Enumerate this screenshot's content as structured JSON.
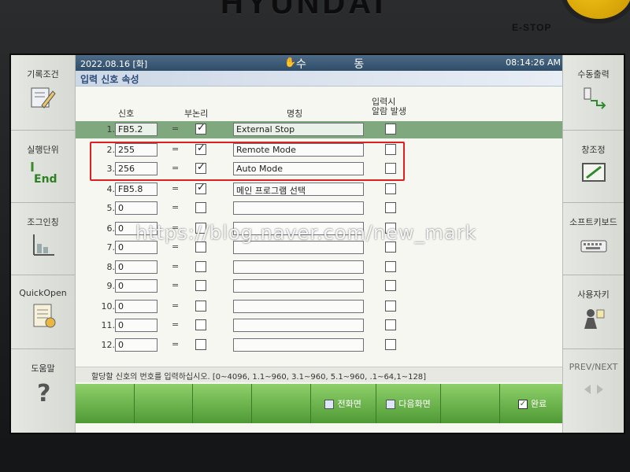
{
  "device": {
    "brand": "HYUNDAI",
    "estop_label": "E-STOP"
  },
  "status": {
    "date": "2022.08.16 [화]",
    "mode": "수 동",
    "time": "08:14:26 AM"
  },
  "screen_title": "입력 신호 속성",
  "columns": {
    "signal": "신호",
    "negation": "부논리",
    "name": "명칭",
    "alarm": "입력시\n알람 발생"
  },
  "rows": [
    {
      "num": "1.",
      "addr": "FB5.2",
      "eq": "=",
      "neg": true,
      "name": "External Stop",
      "alarm": false
    },
    {
      "num": "2.",
      "addr": "255",
      "eq": "=",
      "neg": true,
      "name": "Remote Mode",
      "alarm": false
    },
    {
      "num": "3.",
      "addr": "256",
      "eq": "=",
      "neg": true,
      "name": "Auto Mode",
      "alarm": false
    },
    {
      "num": "4.",
      "addr": "FB5.8",
      "eq": "=",
      "neg": true,
      "name": "메인 프로그램 선택",
      "alarm": false
    },
    {
      "num": "5.",
      "addr": "0",
      "eq": "=",
      "neg": false,
      "name": "",
      "alarm": false
    },
    {
      "num": "6.",
      "addr": "0",
      "eq": "=",
      "neg": false,
      "name": "",
      "alarm": false
    },
    {
      "num": "7.",
      "addr": "0",
      "eq": "=",
      "neg": false,
      "name": "",
      "alarm": false
    },
    {
      "num": "8.",
      "addr": "0",
      "eq": "=",
      "neg": false,
      "name": "",
      "alarm": false
    },
    {
      "num": "9.",
      "addr": "0",
      "eq": "=",
      "neg": false,
      "name": "",
      "alarm": false
    },
    {
      "num": "10.",
      "addr": "0",
      "eq": "=",
      "neg": false,
      "name": "",
      "alarm": false
    },
    {
      "num": "11.",
      "addr": "0",
      "eq": "=",
      "neg": false,
      "name": "",
      "alarm": false
    },
    {
      "num": "12.",
      "addr": "0",
      "eq": "=",
      "neg": false,
      "name": "",
      "alarm": false
    }
  ],
  "hint": "할당할 신호의 번호를 입력하십시오. [0~4096, 1.1~960, 3.1~960, 5.1~960, .1~64,1~128]",
  "left_menu": [
    {
      "label": "기록조건",
      "icon": "edit-pencil-icon"
    },
    {
      "label": "실행단위",
      "icon": "end-icon"
    },
    {
      "label": "조그인칭",
      "icon": "jog-inching-icon"
    },
    {
      "label": "QuickOpen",
      "icon": "quick-open-icon"
    },
    {
      "label": "도움말",
      "icon": "help-icon"
    }
  ],
  "right_menu": [
    {
      "label": "수동출력",
      "icon": "manual-output-icon"
    },
    {
      "label": "창조정",
      "icon": "window-adjust-icon"
    },
    {
      "label": "소프트키보드",
      "icon": "soft-keyboard-icon"
    },
    {
      "label": "사용자키",
      "icon": "user-key-icon"
    },
    {
      "label": "PREV/NEXT",
      "icon": "prev-next-icon"
    }
  ],
  "bottom_keys": [
    "",
    "",
    "",
    "",
    "전화면",
    "다음화면",
    "",
    "완료",
    ""
  ],
  "watermark": "https://blog.naver.com/new_mark"
}
